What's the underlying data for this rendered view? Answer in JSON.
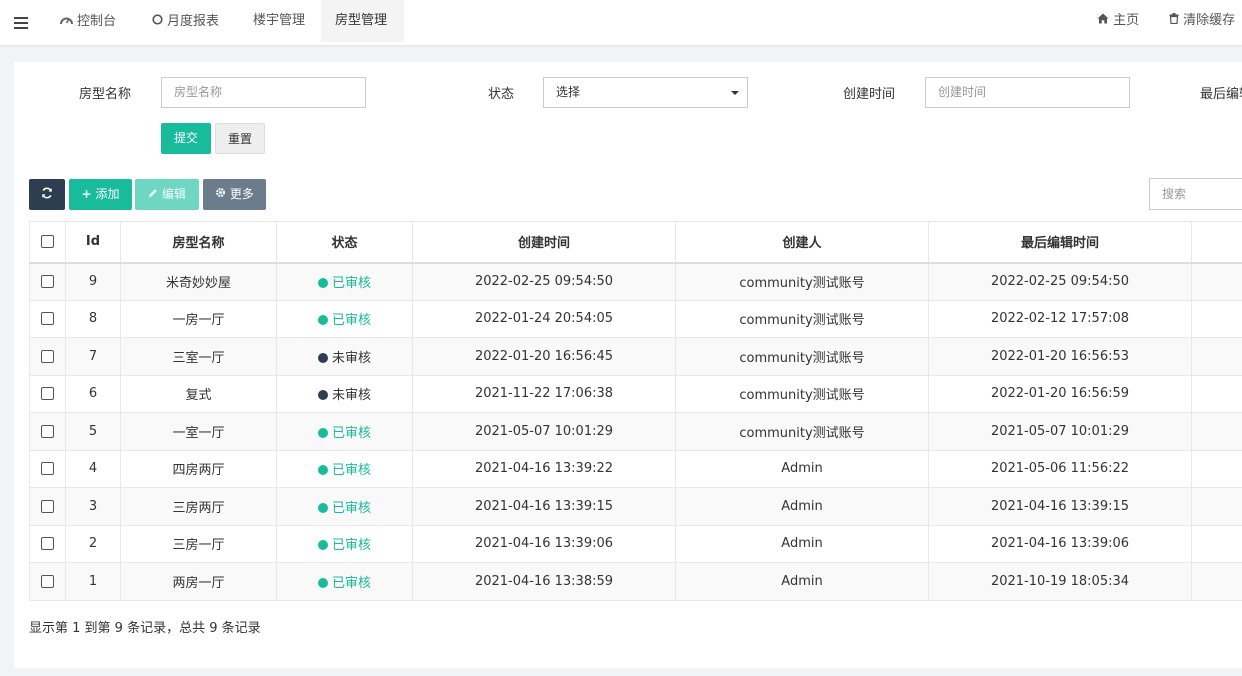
{
  "nav": {
    "tabs": [
      {
        "icon": "dashboard-icon",
        "label": "控制台"
      },
      {
        "icon": "circle-icon",
        "label": "月度报表"
      },
      {
        "label": "楼宇管理"
      },
      {
        "label": "房型管理"
      }
    ],
    "home_label": "主页",
    "clear_cache_label": "清除缓存"
  },
  "filters": {
    "name_label": "房型名称",
    "name_placeholder": "房型名称",
    "status_label": "状态",
    "status_value": "选择",
    "created_label": "创建时间",
    "created_placeholder": "创建时间",
    "edited_label": "最后编辑",
    "submit_label": "提交",
    "reset_label": "重置"
  },
  "toolbar": {
    "add_label": "添加",
    "edit_label": "编辑",
    "more_label": "更多",
    "search_placeholder": "搜索"
  },
  "colors": {
    "accent": "#18bc9c",
    "dark": "#2c3e50"
  },
  "table": {
    "columns": [
      "Id",
      "房型名称",
      "状态",
      "创建时间",
      "创建人",
      "最后编辑时间"
    ],
    "rows": [
      {
        "id": "9",
        "name": "米奇妙妙屋",
        "status": "已审核",
        "status_ok": true,
        "created": "2022-02-25 09:54:50",
        "creator": "community测试账号",
        "edited": "2022-02-25 09:54:50"
      },
      {
        "id": "8",
        "name": "一房一厅",
        "status": "已审核",
        "status_ok": true,
        "created": "2022-01-24 20:54:05",
        "creator": "community测试账号",
        "edited": "2022-02-12 17:57:08"
      },
      {
        "id": "7",
        "name": "三室一厅",
        "status": "未审核",
        "status_ok": false,
        "created": "2022-01-20 16:56:45",
        "creator": "community测试账号",
        "edited": "2022-01-20 16:56:53"
      },
      {
        "id": "6",
        "name": "复式",
        "status": "未审核",
        "status_ok": false,
        "created": "2021-11-22 17:06:38",
        "creator": "community测试账号",
        "edited": "2022-01-20 16:56:59"
      },
      {
        "id": "5",
        "name": "一室一厅",
        "status": "已审核",
        "status_ok": true,
        "created": "2021-05-07 10:01:29",
        "creator": "community测试账号",
        "edited": "2021-05-07 10:01:29"
      },
      {
        "id": "4",
        "name": "四房两厅",
        "status": "已审核",
        "status_ok": true,
        "created": "2021-04-16 13:39:22",
        "creator": "Admin",
        "edited": "2021-05-06 11:56:22"
      },
      {
        "id": "3",
        "name": "三房两厅",
        "status": "已审核",
        "status_ok": true,
        "created": "2021-04-16 13:39:15",
        "creator": "Admin",
        "edited": "2021-04-16 13:39:15"
      },
      {
        "id": "2",
        "name": "三房一厅",
        "status": "已审核",
        "status_ok": true,
        "created": "2021-04-16 13:39:06",
        "creator": "Admin",
        "edited": "2021-04-16 13:39:06"
      },
      {
        "id": "1",
        "name": "两房一厅",
        "status": "已审核",
        "status_ok": true,
        "created": "2021-04-16 13:38:59",
        "creator": "Admin",
        "edited": "2021-10-19 18:05:34"
      }
    ]
  },
  "pager": {
    "info": "显示第 1 到第 9 条记录，总共 9 条记录"
  }
}
